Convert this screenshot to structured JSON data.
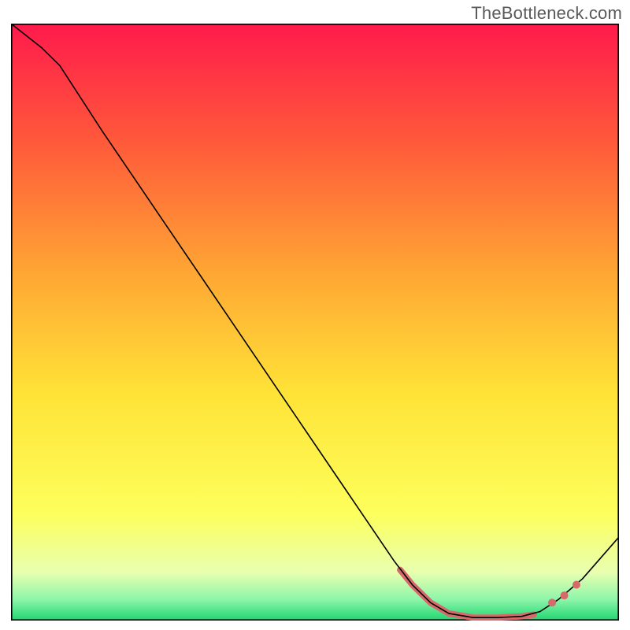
{
  "watermark": {
    "text": "TheBottleneck.com"
  },
  "chart_data": {
    "type": "line",
    "title": "",
    "xlabel": "",
    "ylabel": "",
    "xlim": [
      0,
      100
    ],
    "ylim": [
      0,
      100
    ],
    "grid": false,
    "legend": false,
    "series": [
      {
        "name": "curve",
        "color": "#000000",
        "stroke_width": 1.6,
        "points": [
          {
            "x": 0,
            "y": 100
          },
          {
            "x": 5,
            "y": 96
          },
          {
            "x": 8,
            "y": 93
          },
          {
            "x": 15,
            "y": 82
          },
          {
            "x": 25,
            "y": 67
          },
          {
            "x": 35,
            "y": 52
          },
          {
            "x": 45,
            "y": 37
          },
          {
            "x": 55,
            "y": 22
          },
          {
            "x": 63,
            "y": 10
          },
          {
            "x": 66,
            "y": 6
          },
          {
            "x": 69,
            "y": 3
          },
          {
            "x": 72,
            "y": 1.2
          },
          {
            "x": 76,
            "y": 0.5
          },
          {
            "x": 80,
            "y": 0.5
          },
          {
            "x": 84,
            "y": 0.7
          },
          {
            "x": 87,
            "y": 1.5
          },
          {
            "x": 90,
            "y": 3.5
          },
          {
            "x": 94,
            "y": 7
          },
          {
            "x": 100,
            "y": 14
          }
        ]
      }
    ],
    "highlight_segment": {
      "color": "#d66a6a",
      "stroke_width": 8,
      "points": [
        {
          "x": 64,
          "y": 8.5
        },
        {
          "x": 66,
          "y": 6
        },
        {
          "x": 69,
          "y": 3
        },
        {
          "x": 72,
          "y": 1.2
        },
        {
          "x": 76,
          "y": 0.5
        },
        {
          "x": 80,
          "y": 0.5
        },
        {
          "x": 84,
          "y": 0.7
        },
        {
          "x": 86,
          "y": 1.0
        }
      ]
    },
    "markers": {
      "color": "#d66a6a",
      "radius": 5,
      "points": [
        {
          "x": 89,
          "y": 3.0
        },
        {
          "x": 91,
          "y": 4.2
        },
        {
          "x": 93,
          "y": 6.0
        }
      ]
    },
    "gradient_stops": [
      {
        "offset": 0.0,
        "color": "#ff1a4c"
      },
      {
        "offset": 0.2,
        "color": "#ff5a3a"
      },
      {
        "offset": 0.42,
        "color": "#ffa734"
      },
      {
        "offset": 0.62,
        "color": "#ffe337"
      },
      {
        "offset": 0.82,
        "color": "#fdff5c"
      },
      {
        "offset": 0.92,
        "color": "#e8ffb0"
      },
      {
        "offset": 0.965,
        "color": "#8cf5a9"
      },
      {
        "offset": 1.0,
        "color": "#1fd66f"
      }
    ],
    "border_color": "#000000"
  }
}
